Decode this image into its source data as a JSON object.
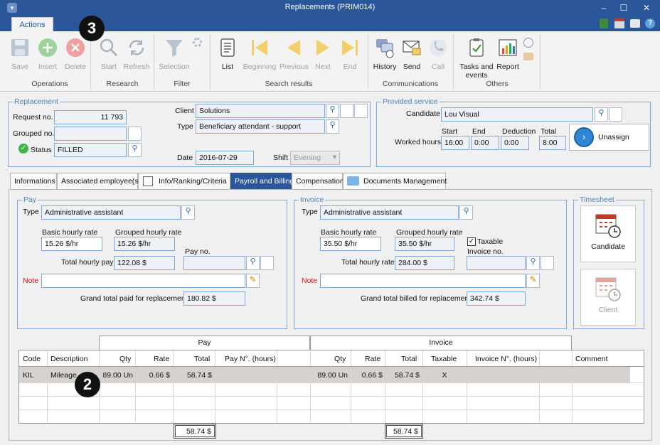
{
  "window": {
    "title": "Replacements (PRIM014)",
    "minimize": "–",
    "maximize": "☐",
    "close": "✕"
  },
  "ribbon": {
    "tab": "Actions",
    "buttons": {
      "save": "Save",
      "insert": "Insert",
      "delete": "Delete",
      "start": "Start",
      "refresh": "Refresh",
      "selection": "Selection",
      "list": "List",
      "beginning": "Beginning",
      "previous": "Previous",
      "next": "Next",
      "end": "End",
      "history": "History",
      "send": "Send",
      "call": "Call",
      "tasks": "Tasks and events",
      "report": "Report"
    },
    "groups": {
      "operations": "Operations",
      "research": "Research",
      "filter": "Filter",
      "search_results": "Search results",
      "communications": "Communications",
      "others": "Others"
    }
  },
  "badges": {
    "top": "3",
    "grid": "2"
  },
  "replacement": {
    "legend": "Replacement",
    "request_label": "Request no.",
    "request_value": "11 793",
    "grouped_label": "Grouped no.",
    "grouped_value": "",
    "status_label": "Status",
    "status_value": "FILLED",
    "client_label": "Client",
    "client_value": "Solutions",
    "type_label": "Type",
    "type_value": "Beneficiary attendant - support",
    "date_label": "Date",
    "date_value": "2016-07-29",
    "shift_label": "Shift",
    "shift_value": "Evening"
  },
  "provided": {
    "legend": "Provided service",
    "candidate_label": "Candidate",
    "candidate_value": "Lou Visual",
    "worked_label": "Worked hours",
    "start_label": "Start",
    "start_value": "16:00",
    "end_label": "End",
    "end_value": "0:00",
    "deduction_label": "Deduction",
    "deduction_value": "0:00",
    "total_label": "Total",
    "total_value": "8:00",
    "unassign": "Unassign"
  },
  "tabs": [
    "Informations",
    "Associated employee(s)",
    "Info/Ranking/Criteria",
    "Payroll and Billing",
    "Compensation",
    "Documents Management"
  ],
  "pay": {
    "legend": "Pay",
    "type_label": "Type",
    "type_value": "Administrative assistant",
    "basic_label": "Basic hourly rate",
    "basic_value": "15.26 $/hr",
    "grouped_label": "Grouped hourly rate",
    "grouped_value": "15.26 $/hr",
    "payno_label": "Pay no.",
    "payno_value": "",
    "total_label": "Total hourly pay",
    "total_value": "122.08 $",
    "note_label": "Note",
    "note_value": "",
    "grand_label": "Grand total paid for replacement",
    "grand_value": "180.82 $"
  },
  "invoice": {
    "legend": "Invoice",
    "type_label": "Type",
    "type_value": "Administrative assistant",
    "basic_label": "Basic hourly rate",
    "basic_value": "35.50 $/hr",
    "grouped_label": "Grouped hourly rate",
    "grouped_value": "35.50 $/hr",
    "taxable_label": "Taxable",
    "invno_label": "Invoice no.",
    "invno_value": "",
    "total_label": "Total hourly rate",
    "total_value": "284.00 $",
    "note_label": "Note",
    "note_value": "",
    "grand_label": "Grand total billed for replacement",
    "grand_value": "342.74 $"
  },
  "timesheet": {
    "legend": "Timesheet",
    "candidate": "Candidate",
    "client": "Client"
  },
  "grid": {
    "group_pay": "Pay",
    "group_invoice": "Invoice",
    "headers": {
      "code": "Code",
      "description": "Description",
      "qty": "Qty",
      "rate": "Rate",
      "total": "Total",
      "payno": "Pay N°. (hours)",
      "iqty": "Qty",
      "irate": "Rate",
      "itotal": "Total",
      "taxable": "Taxable",
      "invno": "Invoice N°. (hours)",
      "comment": "Comment"
    },
    "row": {
      "code": "KIL",
      "description": "Mileage",
      "qty": "89.00 Un",
      "rate": "0.66 $",
      "total": "58.74 $",
      "payno": "",
      "iqty": "89.00 Un",
      "irate": "0.66 $",
      "itotal": "58.74 $",
      "taxable": "X",
      "invno": "",
      "comment": ""
    },
    "pay_total": "58.74 $",
    "invoice_total": "58.74 $"
  }
}
